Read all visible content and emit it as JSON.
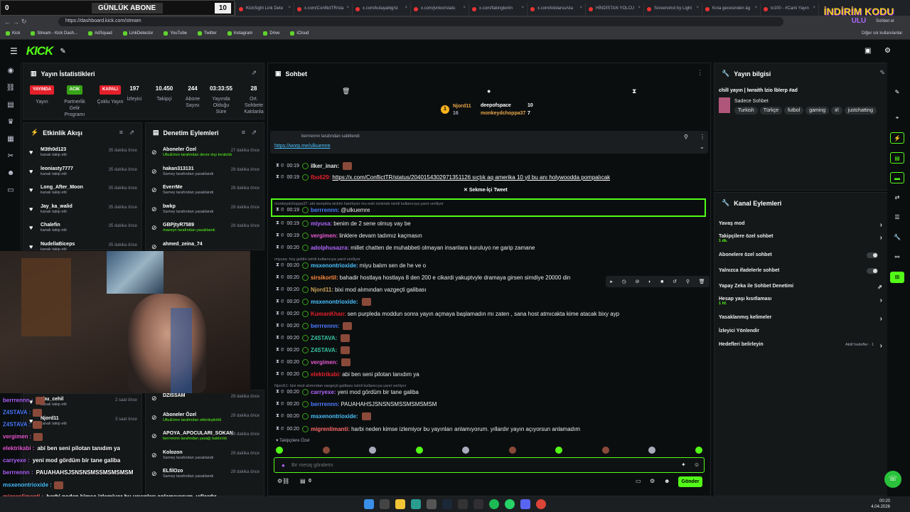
{
  "browser": {
    "tabs": [
      "FUTBOLCU KUB...",
      "GÜNLÜK ABONE",
      "OnlyDrama TV",
      "Stream - Kick Dashb",
      "KickSight Link Dete",
      "x.com/ConflictTR/sta",
      "x.com/kutayabig/st",
      "x.com/jvnkor/statu",
      "x.com/fakingterim",
      "x.com/lotolarsu/sta",
      "HİNDİSTAN YOLCU",
      "Screenshot by Light",
      "Kına gecesinden äg",
      "tv100 - #Canlı Yayın"
    ],
    "url": "https://dashboard.kick.com/stream",
    "bookmarks": [
      "Kick",
      "Stream - Kick Dash...",
      "AdSquad",
      "LinkDetector",
      "YouTube",
      "Twitter",
      "Instagram",
      "Drive",
      "iCloud"
    ],
    "bookmarks_other": "Diğer sık kullanılanlar",
    "chat_btn": "Sohbet et"
  },
  "overlay": {
    "sub_goal_left": "0",
    "sub_goal_title": "GÜNLÜK ABONE",
    "sub_goal_right": "10",
    "promo": "İNDİRİM KODU",
    "promo_sub": "ULU"
  },
  "kick": {
    "logo": "KICK"
  },
  "stats": {
    "title": "Yayın İstatistikleri",
    "cols": [
      {
        "badge": "YAYINDA",
        "badge_color": "#e4202b",
        "label": "Yayın"
      },
      {
        "badge": "ACIK",
        "badge_color": "#38a317",
        "label": "Partnerlik Gelir Programı"
      },
      {
        "badge": "KAPALI",
        "badge_color": "#e4202b",
        "label": "Çoklu Yayın"
      },
      {
        "num": "197",
        "label": "İzleyici"
      },
      {
        "num": "10.450",
        "label": "Takipçi"
      },
      {
        "num": "244",
        "label": "Abone Sayısı"
      },
      {
        "num": "03:33:55",
        "label": "Yayında Olduğu Süre"
      },
      {
        "num": "28",
        "label": "Ort. Sohbete Katılanla"
      }
    ]
  },
  "activity": {
    "title": "Etkinlik Akışı",
    "items": [
      {
        "name": "M3th0d123",
        "sub": "kanalı takip etti",
        "time": "35 dakika önce"
      },
      {
        "name": "leoniasty7777",
        "sub": "kanalı takip etti",
        "time": "35 dakika önce"
      },
      {
        "name": "Long_After_Moon",
        "sub": "kanalı takip etti",
        "time": "35 dakika önce"
      },
      {
        "name": "Jay_ka_walid",
        "sub": "kanalı takip etti",
        "time": "35 dakika önce"
      },
      {
        "name": "Chalefin",
        "sub": "kanalı takip etti",
        "time": "35 dakika önce"
      },
      {
        "name": "NudellaBiceps",
        "sub": "kanalı takip etti",
        "time": "35 dakika önce"
      }
    ],
    "lower": [
      {
        "name": "ebu_cehil",
        "sub": "kanalı takip etti",
        "time": "2 saat önce"
      },
      {
        "name": "Njord11",
        "sub": "kanalı takip etti",
        "time": "3 saat önce"
      }
    ]
  },
  "moderation": {
    "title": "Denetim Eylemleri",
    "items": [
      {
        "name": "Aboneler Özel",
        "sub": "UlkuEmre tarafından devre dışı bırakıldı",
        "time": "27 dakika önce"
      },
      {
        "name": "hakan313131",
        "sub": "Sarney tarafından yasaklandı",
        "time": "28 dakika önce"
      },
      {
        "name": "EverrMe",
        "sub": "Sarney tarafından yasaklandı",
        "time": "28 dakika önce"
      },
      {
        "name": "bwkp",
        "sub": "Sarney tarafından yasaklandı",
        "time": "28 dakika önce"
      },
      {
        "name": "GBPjtyR7589",
        "sub": "maeeyn tarafından yasaklandı",
        "time": "28 dakika önce"
      },
      {
        "name": "ahmed_zeina_74",
        "sub": "",
        "time": ""
      }
    ],
    "lower": [
      {
        "name": "DZISSAM",
        "sub": "",
        "time": "29 dakika önce"
      },
      {
        "name": "Aboneler Özel",
        "sub": "UlkuEmre tarafından etkinleştirildi",
        "time": "29 dakika önce"
      },
      {
        "name": "APOYA_APOCULARI_SOKAN",
        "sub": "berrrennn tarafından yasağı kaldırıldı",
        "time": "29 dakika önce"
      },
      {
        "name": "Kolozon",
        "sub": "Sarney tarafından yasaklandı",
        "time": "29 dakika önce"
      },
      {
        "name": "ELfilOzo",
        "sub": "Sarney tarafından yasaklandı",
        "time": "29 dakika önce"
      }
    ]
  },
  "chat": {
    "title": "Sohbet",
    "top_users": [
      {
        "name": "Njord11",
        "count": "16"
      },
      {
        "name": "deepofspace",
        "count": "10"
      },
      {
        "name": "monkeydchoppa37",
        "count": "7"
      }
    ],
    "pinned_by": "berrrennn tarafından sabitlendi",
    "pinned_link": "https://worp.me/ulkuemre",
    "messages": [
      {
        "time": "00:19",
        "user": "ilker_inan:",
        "color": "#e8e8e8",
        "text": ""
      },
      {
        "time": "00:19",
        "user": "fbo629:",
        "color": "#e4202b",
        "text": "https://x.com/ConflictTR/status/2040154302971351126 sıçtık aq amerika 10 yil bu anı holywoodda pompalıcak"
      },
      {
        "time": "00:19",
        "user": "berrrennn:",
        "color": "#4a7bff",
        "text": "@ulkuemre",
        "reply": "monkeydchoppa37: abi xerephia nickini hatırlıyon mu eski nickinde isimli kullanıcıya yanıt veriliyor"
      },
      {
        "time": "00:19",
        "user": "miyusa:",
        "color": "#b066ff",
        "text": "benim de 2 sene olmuş vay be"
      },
      {
        "time": "00:19",
        "user": "vergimen:",
        "color": "#e85ad3",
        "text": "linklere devam tadımız kaçmasın"
      },
      {
        "time": "00:20",
        "user": "adolphusazra:",
        "color": "#b066ff",
        "text": "millet chatten de muhabbeti olmayan insanlara kuruluyo ne garip zamane"
      },
      {
        "time": "00:20",
        "user": "msxenontrioxide:",
        "color": "#4ac1ff",
        "text": "miyu balım sen de he ve o",
        "reply": "miyusa: hoş geldin isimli kullanıcıya yanıt veriliyor"
      },
      {
        "time": "00:20",
        "user": "sirsikortil:",
        "color": "#ff8a3d",
        "text": "bahadir hostlaya hostlaya 8 den 200 e cikardi yakuptvyle dramaya girsen simdiye 20000 din"
      },
      {
        "time": "00:20",
        "user": "Njord11:",
        "color": "#c9a25b",
        "text": "bixi mod alımından vazgeçti galibası"
      },
      {
        "time": "00:20",
        "user": "msxenontrioxide:",
        "color": "#4ac1ff",
        "text": ""
      },
      {
        "time": "00:20",
        "user": "KumanKhan:",
        "color": "#e4202b",
        "text": "sen purpleda moddun sonra yayın açmaya başlamadın mı zaten , sana host atmıcakta kime atacak bixy ayp"
      },
      {
        "time": "00:20",
        "user": "berrrennn:",
        "color": "#4a7bff",
        "text": ""
      },
      {
        "time": "00:20",
        "user": "Z4STAVA:",
        "color": "#38c1a3",
        "text": ""
      },
      {
        "time": "00:20",
        "user": "Z4STAVA:",
        "color": "#38c1a3",
        "text": ""
      },
      {
        "time": "00:20",
        "user": "vergimen:",
        "color": "#e85ad3",
        "text": ""
      },
      {
        "time": "00:20",
        "user": "elektrikabi:",
        "color": "#e4202b",
        "text": "abi ben seni pilotan tanıdım ya"
      },
      {
        "time": "00:20",
        "user": "carryexe:",
        "color": "#b066ff",
        "text": "yeni mod gördüm bir tane galiba",
        "reply": "Njord11: bixi mod alımından vazgeçti galibası isimli kullanıcıya yanıt veriliyor"
      },
      {
        "time": "00:20",
        "user": "berrrennn:",
        "color": "#4a7bff",
        "text": "PAUAHAHSJSNSNSMSSMSMSMSM"
      },
      {
        "time": "00:20",
        "user": "msxenontrioxide:",
        "color": "#4ac1ff",
        "text": ""
      },
      {
        "time": "00:20",
        "user": "migrenlimanti:",
        "color": "#ff6a6a",
        "text": "harbi neden kimse izlemiyor bu yayınları anlamıyorum. yıllardır yayın açıyorsun anlamadım"
      }
    ],
    "tweet_label": "Sekme-İçi Tweet",
    "followers_only": "Takipçilere Özel",
    "input_placeholder": "Bir mesaj gönderin",
    "points": "0",
    "send_label": "Gönder"
  },
  "info": {
    "title": "Yayın bilgisi",
    "stream_title": "chill yayın | lwraith lzio lblerp #ad",
    "category": "Sadece Sohbet",
    "tags": [
      "Turkish",
      "Türkçe",
      "futbol",
      "gaming",
      "irl",
      "justchatting"
    ]
  },
  "actions": {
    "title": "Kanal Eylemleri",
    "rows": [
      {
        "label": "Yavaş mod",
        "sub": "",
        "ctrl": "chev"
      },
      {
        "label": "Takipçilere özel sohbet",
        "sub": "1 dk.",
        "ctrl": "chev"
      },
      {
        "label": "Abonelere özel sohbet",
        "sub": "",
        "ctrl": "toggle"
      },
      {
        "label": "Yalnızca ifadelerle sohbet",
        "sub": "",
        "ctrl": "toggle"
      },
      {
        "label": "Yapay Zeka ile Sohbet Denetimi",
        "sub": "",
        "ctrl": "ext"
      },
      {
        "label": "Hesap yaşı kısıtlaması",
        "sub": "1 hf.",
        "ctrl": "chev"
      },
      {
        "label": "Yasaklanmış kelimeler",
        "sub": "",
        "ctrl": "chev"
      },
      {
        "label": "İzleyici Yönlendir",
        "sub": "",
        "ctrl": ""
      },
      {
        "label": "Hedefleri belirleyin",
        "sub": "",
        "ctrl": "chev",
        "extra": "Aktif hedefler · 1"
      }
    ]
  },
  "overlay_chat": [
    {
      "user": "berrrennn :",
      "color": "#b066ff",
      "text": ""
    },
    {
      "user": "Z4STAVA :",
      "color": "#4a7bff",
      "text": ""
    },
    {
      "user": "Z4STAVA :",
      "color": "#4a7bff",
      "text": ""
    },
    {
      "user": "vergimen :",
      "color": "#e85ad3",
      "text": ""
    },
    {
      "user": "elektrikabi :",
      "color": "#e85ad3",
      "text": "abi ben seni pilotan tanıdım ya"
    },
    {
      "user": "carryexe :",
      "color": "#b066ff",
      "text": "yeni mod gördüm bir tane galiba"
    },
    {
      "user": "berrrennn :",
      "color": "#b066ff",
      "text": "PAUAHAHSJSNSNSMSSMSMSMSM"
    },
    {
      "user": "msxenontrioxide :",
      "color": "#4ac1ff",
      "text": ""
    },
    {
      "user": "migrenlimanti :",
      "color": "#ff6a6a",
      "text": "harbi neden kimse izlemiyor bu yayınları anlamıyorum. yıllardır yayın açıyorsun anlamadım"
    }
  ],
  "clock": {
    "time": "00:20",
    "date": "4.04.2026"
  }
}
